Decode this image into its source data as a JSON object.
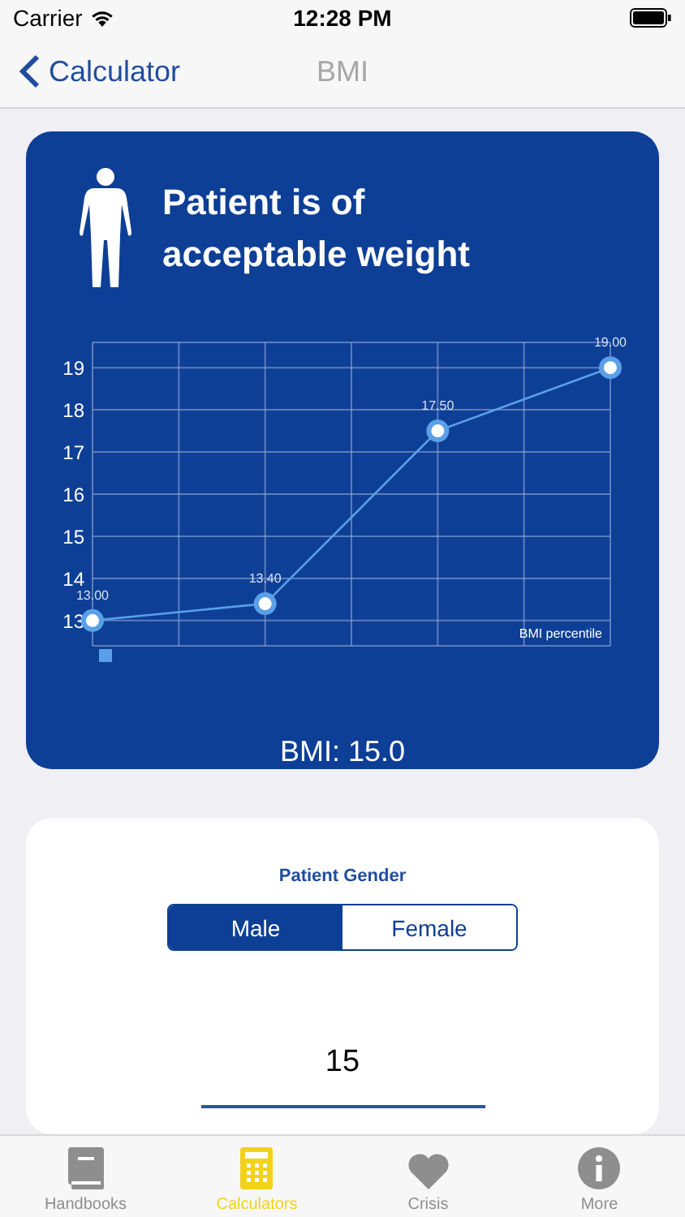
{
  "status_bar": {
    "carrier": "Carrier",
    "time": "12:28 PM"
  },
  "nav": {
    "back": "Calculator",
    "title": "BMI"
  },
  "result": {
    "title": "Patient is of acceptable weight",
    "bmi": "BMI: 15.0",
    "chart_data": {
      "type": "line",
      "xlabel": "BMI percentile",
      "categories": [
        null,
        null,
        null,
        null
      ],
      "ylim": [
        12.4,
        19.6
      ],
      "yticks": [
        13,
        14,
        15,
        16,
        17,
        18,
        19
      ],
      "grid": true,
      "series": [
        {
          "color": "#5aa0e8",
          "marker": "circle",
          "values": [
            13,
            13.4,
            17.5,
            19
          ],
          "value_labels": [
            "13.00",
            "13.40",
            "17.50",
            "19.00"
          ]
        }
      ]
    }
  },
  "gender": {
    "label": "Patient Gender",
    "options": [
      {
        "label": "Male",
        "selected": true
      },
      {
        "label": "Female",
        "selected": false
      }
    ]
  },
  "picker": {
    "value": "15"
  },
  "tabs": [
    {
      "label": "Handbooks",
      "selected": false
    },
    {
      "label": "Calculators",
      "selected": true
    },
    {
      "label": "Crisis",
      "selected": false
    },
    {
      "label": "More",
      "selected": false
    }
  ]
}
